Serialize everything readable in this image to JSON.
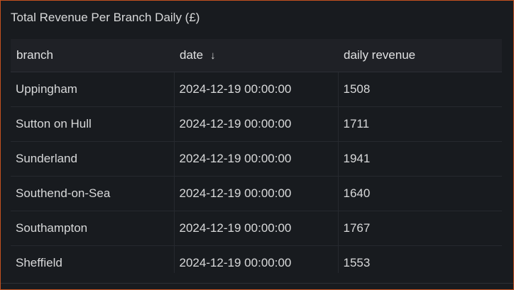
{
  "panel": {
    "title": "Total Revenue Per Branch Daily (£)"
  },
  "table": {
    "columns": [
      {
        "label": "branch"
      },
      {
        "label": "date",
        "sort_icon": "arrow-down-icon",
        "sort_glyph": "↓"
      },
      {
        "label": "daily revenue"
      }
    ],
    "rows": [
      {
        "branch": "Uppingham",
        "date": "2024-12-19 00:00:00",
        "daily_revenue": "1508"
      },
      {
        "branch": "Sutton on Hull",
        "date": "2024-12-19 00:00:00",
        "daily_revenue": "1711"
      },
      {
        "branch": "Sunderland",
        "date": "2024-12-19 00:00:00",
        "daily_revenue": "1941"
      },
      {
        "branch": "Southend-on-Sea",
        "date": "2024-12-19 00:00:00",
        "daily_revenue": "1640"
      },
      {
        "branch": "Southampton",
        "date": "2024-12-19 00:00:00",
        "daily_revenue": "1767"
      },
      {
        "branch": "Sheffield",
        "date": "2024-12-19 00:00:00",
        "daily_revenue": "1553"
      }
    ]
  },
  "colors": {
    "panel_border": "#c4511f",
    "panel_background": "#181b1f",
    "header_background": "#1f2126",
    "text": "#d8d9da"
  }
}
